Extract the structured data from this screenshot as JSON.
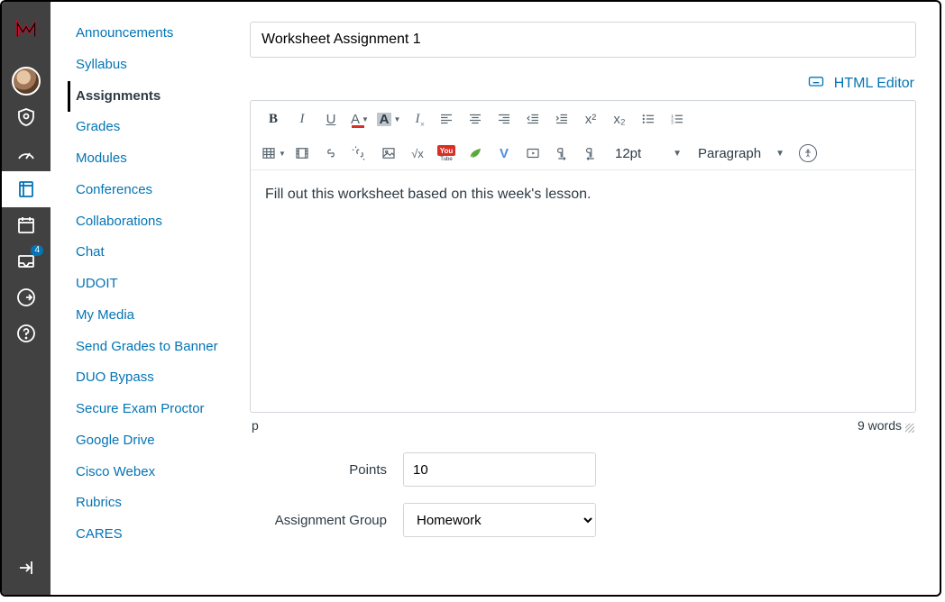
{
  "globalNav": {
    "inboxBadge": "4"
  },
  "courseNav": {
    "items": [
      {
        "label": "Announcements"
      },
      {
        "label": "Syllabus"
      },
      {
        "label": "Assignments",
        "active": true
      },
      {
        "label": "Grades"
      },
      {
        "label": "Modules"
      },
      {
        "label": "Conferences"
      },
      {
        "label": "Collaborations"
      },
      {
        "label": "Chat"
      },
      {
        "label": "UDOIT"
      },
      {
        "label": "My Media"
      },
      {
        "label": "Send Grades to Banner"
      },
      {
        "label": "DUO Bypass"
      },
      {
        "label": "Secure Exam Proctor"
      },
      {
        "label": "Google Drive"
      },
      {
        "label": "Cisco Webex"
      },
      {
        "label": "Rubrics"
      },
      {
        "label": "CARES"
      }
    ]
  },
  "assignment": {
    "titleValue": "Worksheet Assignment 1",
    "htmlEditorLink": "HTML Editor",
    "body": "Fill out this worksheet based on this week's lesson.",
    "pathDisplay": "p",
    "wordCount": "9 words",
    "fontSize": "12pt",
    "blockFormat": "Paragraph"
  },
  "form": {
    "pointsLabel": "Points",
    "pointsValue": "10",
    "groupLabel": "Assignment Group",
    "groupValue": "Homework"
  },
  "toolbar": {
    "bold": "B",
    "italic": "I",
    "underline": "U",
    "fontcolor": "A",
    "bgcolor": "A",
    "clearfmt_glyph": "I",
    "youtube_top": "You",
    "youtube_bottom": "Tube",
    "vimeo": "V",
    "math": "√x",
    "sup": "x²",
    "sub": "x₂"
  }
}
